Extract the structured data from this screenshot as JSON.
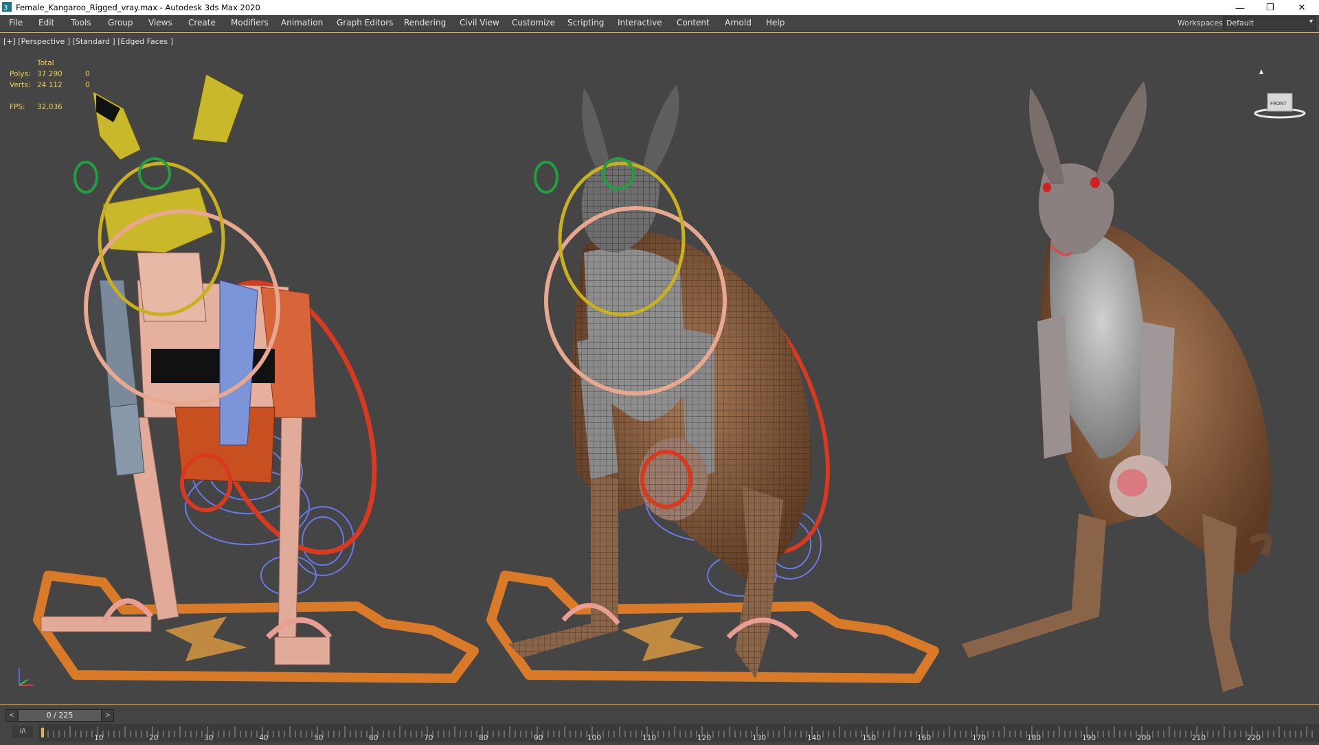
{
  "window": {
    "title": "Female_Kangaroo_Rigged_vray.max - Autodesk 3ds Max 2020",
    "icon": "3ds-max-icon",
    "controls": {
      "minimize": "—",
      "restore": "❐",
      "close": "✕"
    }
  },
  "menu": {
    "items": [
      {
        "label": "File"
      },
      {
        "label": "Edit"
      },
      {
        "label": "Tools"
      },
      {
        "label": "Group"
      },
      {
        "label": "Views"
      },
      {
        "label": "Create"
      },
      {
        "label": "Modifiers"
      },
      {
        "label": "Animation"
      },
      {
        "label": "Graph Editors"
      },
      {
        "label": "Rendering"
      },
      {
        "label": "Civil View"
      },
      {
        "label": "Customize"
      },
      {
        "label": "Scripting"
      },
      {
        "label": "Interactive"
      },
      {
        "label": "Content"
      },
      {
        "label": "Arnold"
      },
      {
        "label": "Help"
      }
    ],
    "workspaces_label": "Workspaces:",
    "workspace_value": "Default"
  },
  "viewport": {
    "label": "[+] [Perspective ] [Standard ] [Edged Faces ]",
    "stats": {
      "total_label": "Total",
      "polys_label": "Polys:",
      "polys_value": "37 290",
      "polys_sel": "0",
      "verts_label": "Verts:",
      "verts_value": "24 112",
      "verts_sel": "0",
      "fps_label": "FPS:",
      "fps_value": "32,036"
    },
    "viewcube_label": "FRONT",
    "colors": {
      "background": "#454545",
      "active_border": "#f0c030",
      "stats_text": "#f0d050",
      "bone_pink": "#e8b0a0",
      "control_orange": "#d06820",
      "control_red": "#d03820",
      "control_yellow": "#d8c020",
      "control_green": "#20a040",
      "control_blue": "#6070d8",
      "kangaroo_brown": "#8a5a3a",
      "kangaroo_grey": "#a8a8a8"
    }
  },
  "timeline": {
    "frame_display": "0 / 225",
    "prev": "<",
    "next": ">",
    "key_mode": "I/\\",
    "ticks": [
      "10",
      "20",
      "30",
      "40",
      "50",
      "60",
      "70",
      "80",
      "90",
      "100",
      "110",
      "120",
      "130",
      "140",
      "150",
      "160",
      "170",
      "180",
      "190",
      "200",
      "210",
      "220"
    ]
  }
}
